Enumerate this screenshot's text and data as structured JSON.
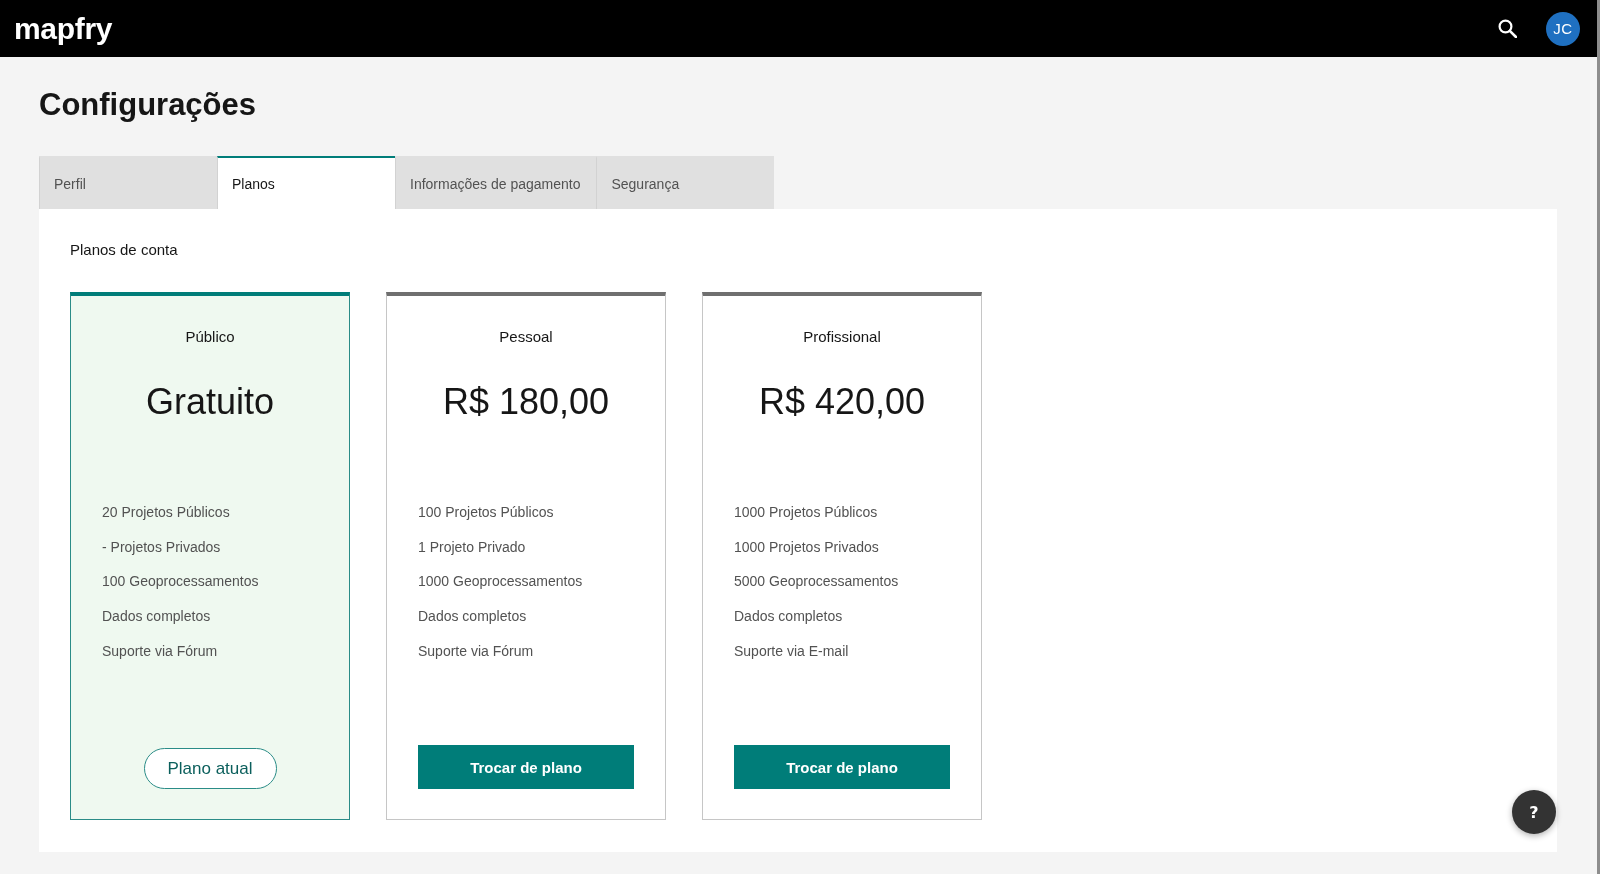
{
  "header": {
    "logo": "mapfry",
    "avatar": "JC"
  },
  "title": "Configurações",
  "tabs": [
    {
      "label": "Perfil",
      "selected": false
    },
    {
      "label": "Planos",
      "selected": true
    },
    {
      "label": "Informações de pagamento",
      "selected": false
    },
    {
      "label": "Segurança",
      "selected": false
    }
  ],
  "section_title": "Planos de conta",
  "plans": [
    {
      "name": "Público",
      "price": "Gratuito",
      "current": true,
      "features": [
        "20 Projetos Públicos",
        "- Projetos Privados",
        "100 Geoprocessamentos",
        "Dados completos",
        "Suporte via Fórum"
      ],
      "button": "Plano atual"
    },
    {
      "name": "Pessoal",
      "price": "R$ 180,00",
      "current": false,
      "features": [
        "100 Projetos Públicos",
        "1 Projeto Privado",
        "1000 Geoprocessamentos",
        "Dados completos",
        "Suporte via Fórum"
      ],
      "button": "Trocar de plano"
    },
    {
      "name": "Profissional",
      "price": "R$ 420,00",
      "current": false,
      "features": [
        "1000 Projetos Públicos",
        "1000 Projetos Privados",
        "5000 Geoprocessamentos",
        "Dados completos",
        "Suporte via E-mail"
      ],
      "button": "Trocar de plano"
    }
  ],
  "help_button": "?"
}
